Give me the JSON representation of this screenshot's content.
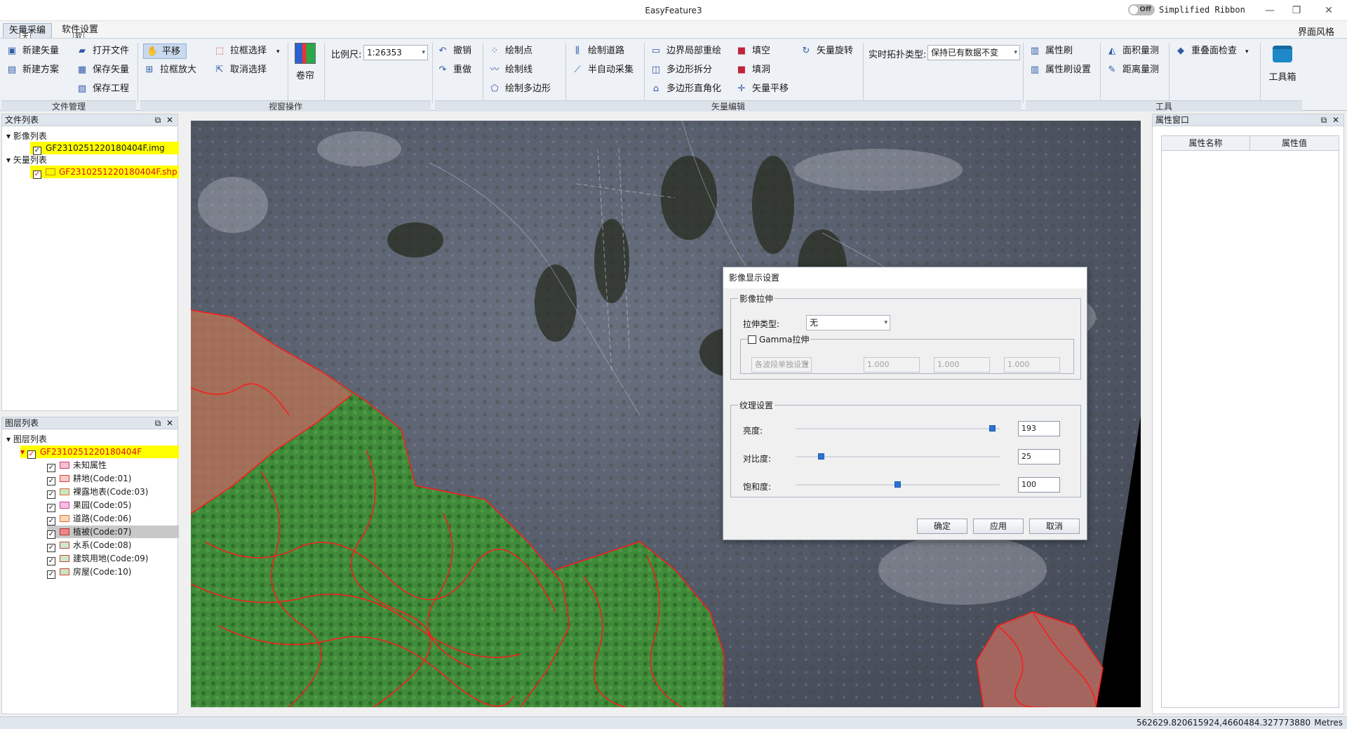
{
  "window": {
    "title": "EasyFeature3",
    "ribbon_toggle": "Off",
    "ribbon_mode": "Simplified Ribbon"
  },
  "menu": {
    "tabs": [
      "矢量采编",
      "软件设置"
    ],
    "ui_style": "界面风格",
    "tooltip_a": "天",
    "tooltip_b": "软"
  },
  "ribbon": {
    "file": {
      "new_vector": "新建矢量",
      "open_file": "打开文件",
      "new_plan": "新建方案",
      "save_vector": "保存矢量",
      "save_project": "保存工程",
      "group": "文件管理"
    },
    "view": {
      "pan": "平移",
      "box_zoom": "拉框放大",
      "box_select": "拉框选择",
      "cancel_select": "取消选择",
      "curtain": "卷帘",
      "scale_label": "比例尺:",
      "scale_value": "1:26353",
      "group": "视窗操作"
    },
    "edit": {
      "undo": "撤销",
      "redo": "重做",
      "draw_point": "绘制点",
      "draw_line": "绘制线",
      "draw_polygon": "绘制多边形",
      "draw_road": "绘制道路",
      "semi_auto": "半自动采集",
      "boundary_redraw": "边界局部重绘",
      "polygon_split": "多边形拆分",
      "polygon_right_angle": "多边形直角化",
      "fill": "填空",
      "fill_hole": "填洞",
      "vector_pan": "矢量平移",
      "vector_rotate": "矢量旋转",
      "topo_label": "实时拓扑类型:",
      "topo_value": "保持已有数据不变",
      "group": "矢量编辑"
    },
    "tools": {
      "attr_brush": "属性刷",
      "attr_brush_settings": "属性刷设置",
      "area_measure": "面积量测",
      "distance_measure": "距离量测",
      "overlap_check": "重叠面检查",
      "toolbox": "工具箱",
      "group": "工具"
    }
  },
  "file_panel": {
    "title": "文件列表",
    "image_group": "影像列表",
    "image_file": "GF2310251220180404F.img",
    "vector_group": "矢量列表",
    "vector_file": "GF2310251220180404F.shp"
  },
  "layer_panel": {
    "title": "图层列表",
    "root": "图层列表",
    "layer": "GF2310251220180404F",
    "items": [
      {
        "label": "未知属性",
        "color": "#f4c2cf",
        "border": "#d23c6a"
      },
      {
        "label": "耕地(Code:01)",
        "color": "#f9c8c8",
        "border": "#e04040"
      },
      {
        "label": "裸露地表(Code:03)",
        "color": "#c7e8c0",
        "border": "#e06a3a"
      },
      {
        "label": "果园(Code:05)",
        "color": "#f6bfe4",
        "border": "#d04090"
      },
      {
        "label": "道路(Code:06)",
        "color": "#fbd7b8",
        "border": "#e0703a"
      },
      {
        "label": "植被(Code:07)",
        "color": "#e88",
        "border": "#b03030"
      },
      {
        "label": "水系(Code:08)",
        "color": "#c9ead0",
        "border": "#d04040"
      },
      {
        "label": "建筑用地(Code:09)",
        "color": "#cdeac6",
        "border": "#d04040"
      },
      {
        "label": "房屋(Code:10)",
        "color": "#c8e6c0",
        "border": "#d04040"
      }
    ]
  },
  "attr_panel": {
    "title": "属性窗口",
    "col_name": "属性名称",
    "col_value": "属性值"
  },
  "dialog": {
    "title": "影像显示设置",
    "stretch_group": "影像拉伸",
    "stretch_type_label": "拉伸类型:",
    "stretch_type_value": "无",
    "gamma_label": "Gamma拉伸",
    "band_mode": "各波段单独设置",
    "gamma_values": [
      "1.000",
      "1.000",
      "1.000"
    ],
    "texture_group": "纹理设置",
    "brightness_label": "亮度:",
    "brightness": "193",
    "contrast_label": "对比度:",
    "contrast": "25",
    "saturation_label": "饱和度:",
    "saturation": "100",
    "ok": "确定",
    "apply": "应用",
    "cancel": "取消"
  },
  "status": {
    "coords": "562629.820615924,4660484.327773880",
    "units": "Metres"
  }
}
